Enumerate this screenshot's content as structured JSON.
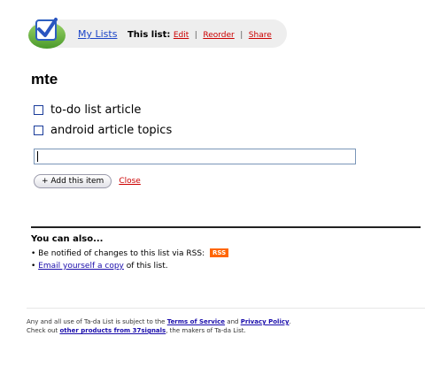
{
  "brand": {
    "logo_icon": "checkmark-logo-icon",
    "accent": "#3a6fd8"
  },
  "nav": {
    "my_lists": "My Lists",
    "this_list_label": "This list:",
    "edit": "Edit",
    "reorder": "Reorder",
    "share": "Share",
    "separator": "|"
  },
  "list": {
    "title": "mte",
    "items": [
      {
        "label": "to-do list article",
        "checked": false
      },
      {
        "label": "android article topics",
        "checked": false
      }
    ],
    "input_value": ""
  },
  "actions": {
    "add_item": "+ Add this item",
    "close": "Close"
  },
  "also": {
    "title": "You can also...",
    "rss_text": "• Be notified of changes to this list via RSS:",
    "rss_badge": "RSS",
    "email_bullet": "• ",
    "email_link": "Email yourself a copy",
    "email_suffix": " of this list."
  },
  "footer": {
    "line1_prefix": "Any and all use of Ta-da List is subject to the ",
    "terms": "Terms of Service",
    "and": " and ",
    "privacy": "Privacy Policy",
    "period": ".",
    "line2_prefix": "Check out ",
    "other_products": "other products from 37signals",
    "line2_suffix": ", the makers of Ta-da List."
  }
}
